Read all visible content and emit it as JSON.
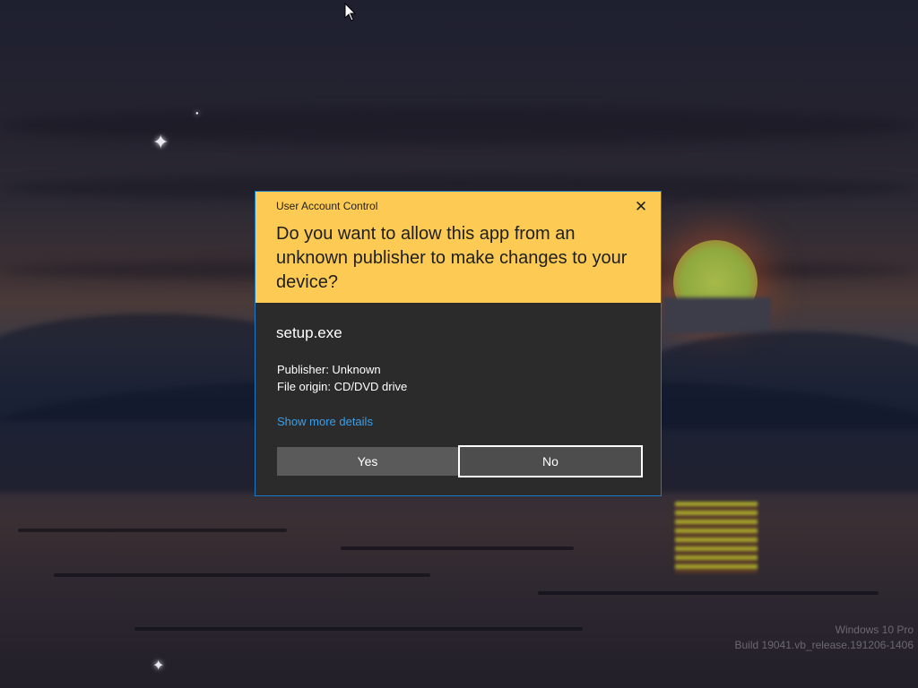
{
  "dialog": {
    "title": "User Account Control",
    "close_icon": "close-icon",
    "question": "Do you want to allow this app from an unknown publisher to make changes to your device?",
    "app_name": "setup.exe",
    "publisher": "Publisher: Unknown",
    "file_origin": "File origin: CD/DVD drive",
    "details_link": "Show more details",
    "yes_label": "Yes",
    "no_label": "No",
    "header_color": "#fdcb53",
    "body_color": "#2b2b2b",
    "link_color": "#3c9fe8"
  },
  "watermark": {
    "edition": "Windows 10 Pro",
    "build": "Build 19041.vb_release.191206-1406"
  }
}
